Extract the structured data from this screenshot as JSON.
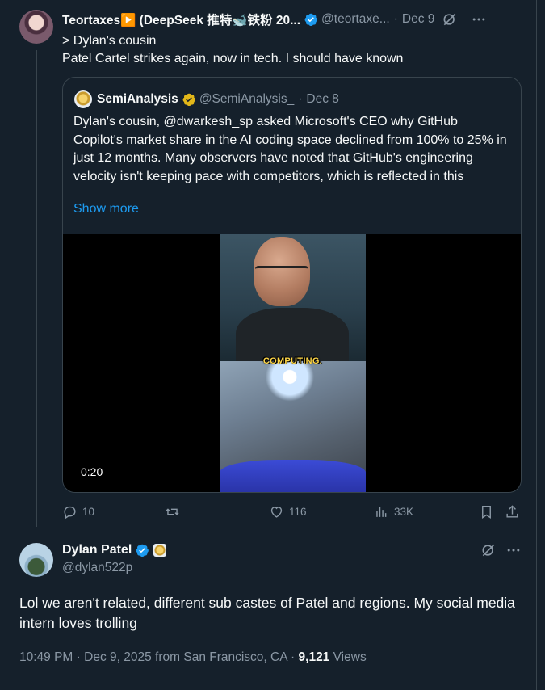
{
  "tweet1": {
    "author_name": "Teortaxes▶️ (DeepSeek 推特🐋铁粉 20...",
    "handle": "@teortaxe...",
    "separator": "·",
    "date": "Dec 9",
    "line1": "> Dylan's cousin",
    "line2": "Patel Cartel strikes again, now in tech. I should have known",
    "quote": {
      "author_name": "SemiAnalysis",
      "handle": "@SemiAnalysis_",
      "separator": "·",
      "date": "Dec 8",
      "text": "Dylan's cousin, @dwarkesh_sp asked Microsoft's CEO why GitHub Copilot's market share in the AI coding space declined from 100% to 25% in just 12 months. Many observers have noted that GitHub's engineering velocity isn't keeping pace with competitors, which is reflected in this",
      "show_more": "Show more",
      "video_caption": "COMPUTING.",
      "video_time": "0:20"
    },
    "actions": {
      "replies": "10",
      "reposts": "",
      "likes": "116",
      "views": "33K"
    }
  },
  "tweet2": {
    "author_name": "Dylan Patel",
    "handle": "@dylan522p",
    "text": "Lol we aren't related, different sub castes of Patel and regions. My social media intern loves trolling",
    "time": "10:49 PM",
    "separator": "·",
    "date": "Dec 9, 2025 from San Francisco, CA",
    "views_count": "9,121",
    "views_label": "Views"
  },
  "colors": {
    "background": "#15202b",
    "accent": "#1d9bf0",
    "muted": "#8b98a5",
    "border": "#38444d",
    "verified_blue": "#1d9bf0",
    "verified_gold": "#e2b719"
  }
}
